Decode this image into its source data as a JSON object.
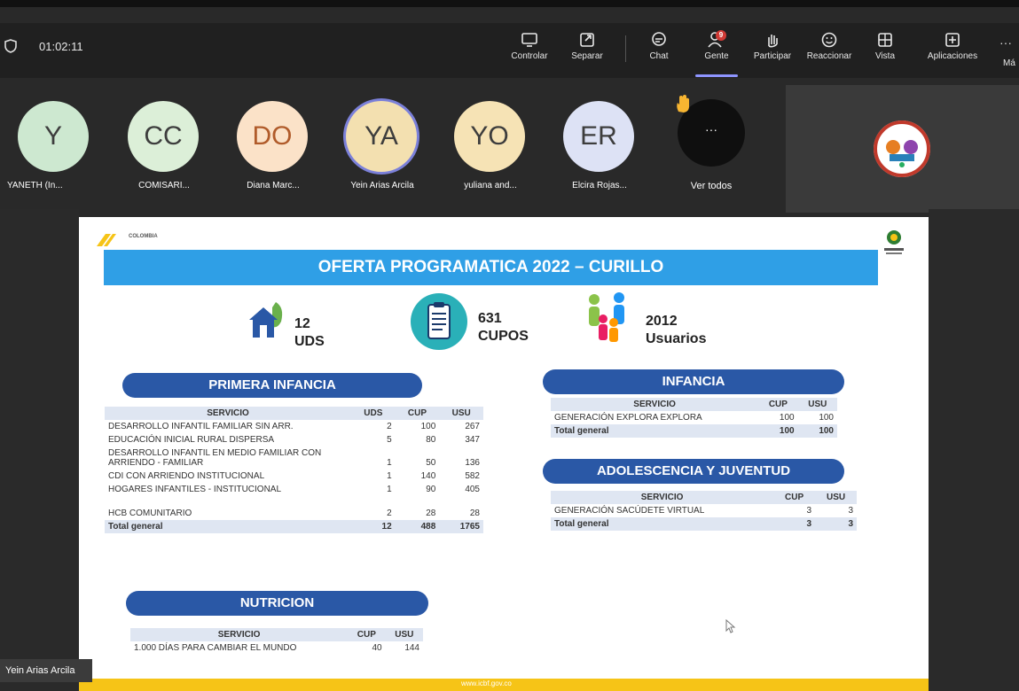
{
  "toolbar": {
    "timer": "01:02:11",
    "buttons": [
      {
        "label": "Controlar",
        "icon": "share-screen-icon"
      },
      {
        "label": "Separar",
        "icon": "pop-out-icon"
      },
      {
        "label": "Chat",
        "icon": "chat-icon"
      },
      {
        "label": "Gente",
        "icon": "people-icon",
        "badge": "9"
      },
      {
        "label": "Participar",
        "icon": "raise-hand-icon"
      },
      {
        "label": "Reaccionar",
        "icon": "smile-icon"
      },
      {
        "label": "Vista",
        "icon": "grid-view-icon"
      },
      {
        "label": "Aplicaciones",
        "icon": "add-apps-icon"
      }
    ],
    "more_label": "Má",
    "active_color": "#8e95ff"
  },
  "participants": [
    {
      "initials": "Y",
      "name": "YANETH (In...",
      "color": "#cde8d0"
    },
    {
      "initials": "CC",
      "name": "COMISARI...",
      "color": "#dcefd8"
    },
    {
      "initials": "DO",
      "name": "Diana Marc...",
      "color": "#fbe2c8"
    },
    {
      "initials": "YA",
      "name": "Yein Arias Arcila",
      "color": "#f3e0b0"
    },
    {
      "initials": "YO",
      "name": "yuliana and...",
      "color": "#f6e3b5"
    },
    {
      "initials": "ER",
      "name": "Elcira Rojas...",
      "color": "#dde2f5"
    }
  ],
  "ver_todos": {
    "label": "Ver todos",
    "dots": "···"
  },
  "speaker_chip": "Yein Arias Arcila",
  "slide": {
    "title": "OFERTA PROGRAMATICA 2022 – CURILLO",
    "logo_text": "COLOMBIA",
    "stats": [
      {
        "value": "12",
        "label": "UDS"
      },
      {
        "value": "631",
        "label": "CUPOS"
      },
      {
        "value": "2012",
        "label": "Usuarios"
      }
    ],
    "primera_infancia": {
      "heading": "PRIMERA INFANCIA",
      "columns": [
        "SERVICIO",
        "UDS",
        "CUP",
        "USU"
      ],
      "rows": [
        [
          "DESARROLLO INFANTIL FAMILIAR SIN ARR.",
          "2",
          "100",
          "267"
        ],
        [
          "EDUCACIÓN INICIAL RURAL DISPERSA",
          "5",
          "80",
          "347"
        ],
        [
          "DESARROLLO INFANTIL EN MEDIO FAMILIAR CON ARRIENDO - FAMILIAR",
          "1",
          "50",
          "136"
        ],
        [
          "CDI CON ARRIENDO INSTITUCIONAL",
          "1",
          "140",
          "582"
        ],
        [
          "HOGARES INFANTILES - INSTITUCIONAL",
          "1",
          "90",
          "405"
        ],
        [
          "HCB COMUNITARIO",
          "2",
          "28",
          "28"
        ]
      ],
      "total": [
        "Total general",
        "12",
        "488",
        "1765"
      ]
    },
    "infancia": {
      "heading": "INFANCIA",
      "columns": [
        "SERVICIO",
        "CUP",
        "USU"
      ],
      "rows": [
        [
          "GENERACIÓN EXPLORA EXPLORA",
          "100",
          "100"
        ]
      ],
      "total": [
        "Total general",
        "100",
        "100"
      ]
    },
    "adolescencia": {
      "heading": "ADOLESCENCIA Y JUVENTUD",
      "columns": [
        "SERVICIO",
        "CUP",
        "USU"
      ],
      "rows": [
        [
          "GENERACIÓN SACÚDETE VIRTUAL",
          "3",
          "3"
        ]
      ],
      "total": [
        "Total general",
        "3",
        "3"
      ]
    },
    "nutricion": {
      "heading": "NUTRICION",
      "columns": [
        "SERVICIO",
        "CUP",
        "USU"
      ],
      "rows": [
        [
          "1.000 DÍAS PARA CAMBIAR EL MUNDO",
          "40",
          "144"
        ]
      ]
    },
    "footer": "www.icbf.gov.co"
  }
}
